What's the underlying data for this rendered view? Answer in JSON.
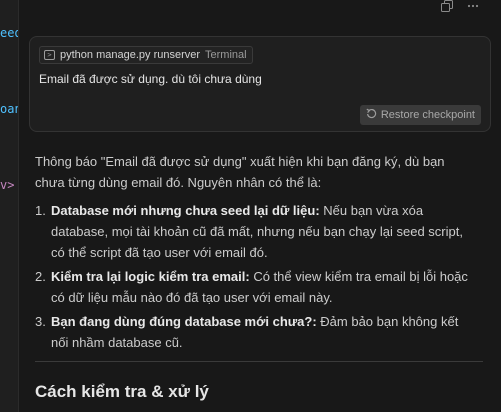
{
  "editor": {
    "fragments": [
      "eed",
      "oan",
      "v>"
    ]
  },
  "top_icons": [
    "copy-icon",
    "more-icon"
  ],
  "card": {
    "command": "python manage.py runserver",
    "command_tag": "Terminal",
    "message": "Email đã được sử dụng. dù tôi chưa dùng",
    "restore_label": "Restore checkpoint"
  },
  "response": {
    "intro": "Thông báo \"Email đã được sử dụng\" xuất hiện khi bạn đăng ký, dù bạn chưa từng dùng email đó. Nguyên nhân có thể là:",
    "items": [
      {
        "num": "1.",
        "title": "Database mới nhưng chưa seed lại dữ liệu:",
        "text": " Nếu bạn vừa xóa database, mọi tài khoản cũ đã mất, nhưng nếu bạn chạy lại seed script, có thể script đã tạo user với email đó."
      },
      {
        "num": "2.",
        "title": "Kiểm tra lại logic kiểm tra email:",
        "text": " Có thể view kiểm tra email bị lỗi hoặc có dữ liệu mẫu nào đó đã tạo user với email này."
      },
      {
        "num": "3.",
        "title": "Bạn đang dùng đúng database mới chưa?:",
        "text": " Đảm bảo bạn không kết nối nhầm database cũ."
      }
    ],
    "heading": "Cách kiểm tra & xử lý"
  }
}
